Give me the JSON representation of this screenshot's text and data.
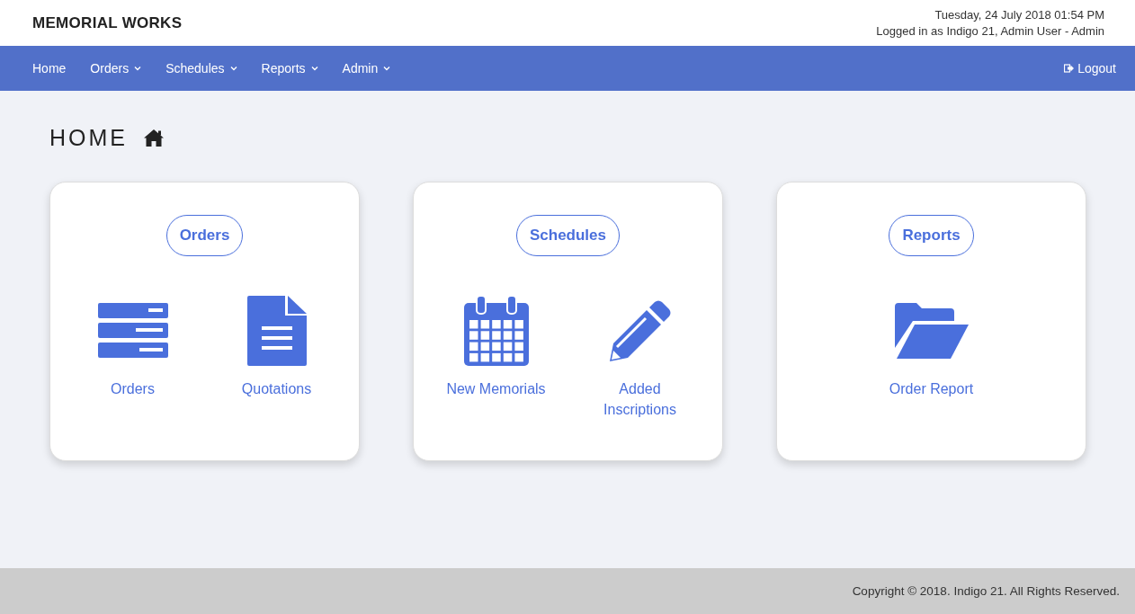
{
  "brand": "MEMORIAL WORKS",
  "datetime": "Tuesday, 24 July 2018 01:54 PM",
  "login": "Logged in as Indigo 21, Admin User - Admin",
  "nav": [
    {
      "label": "Home",
      "dropdown": false
    },
    {
      "label": "Orders",
      "dropdown": true
    },
    {
      "label": "Schedules",
      "dropdown": true
    },
    {
      "label": "Reports",
      "dropdown": true
    },
    {
      "label": "Admin",
      "dropdown": true
    }
  ],
  "logout": "Logout",
  "page_title": "HOME",
  "cards": [
    {
      "title": "Orders",
      "links": [
        {
          "label": "Orders",
          "kind": "list"
        },
        {
          "label": "Quotations",
          "kind": "document"
        }
      ]
    },
    {
      "title": "Schedules",
      "links": [
        {
          "label": "New Memorials",
          "kind": "calendar"
        },
        {
          "label": "Added Inscriptions",
          "kind": "pencil"
        }
      ]
    },
    {
      "title": "Reports",
      "links": [
        {
          "label": "Order Report",
          "kind": "folder"
        }
      ]
    }
  ],
  "footer": "Copyright © 2018. Indigo 21. All Rights Reserved."
}
